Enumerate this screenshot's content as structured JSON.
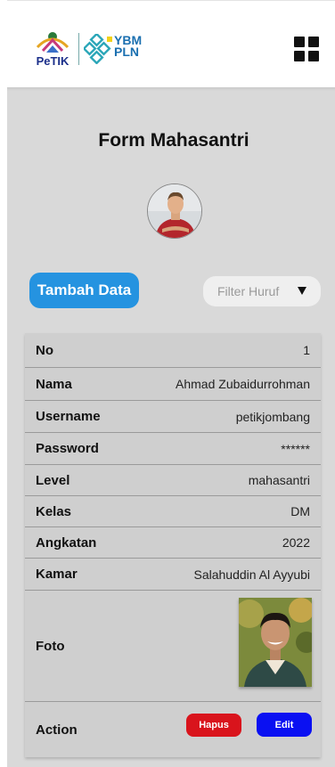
{
  "header": {
    "logo_petik_text": "PeTIK",
    "logo_ybm_line1": "YBM",
    "logo_ybm_line2": "PLN",
    "menu_icon": "grid-menu-icon"
  },
  "page": {
    "title": "Form Mahasantri",
    "avatar_icon": "user-avatar"
  },
  "toolbar": {
    "add_label": "Tambah Data",
    "filter_placeholder": "Filter Huruf",
    "filter_icon": "caret-down-icon"
  },
  "record": {
    "rows": [
      {
        "label": "No",
        "value": "1"
      },
      {
        "label": "Nama",
        "value": "Ahmad Zubaidurrohman"
      },
      {
        "label": "Username",
        "value": "petikjombang"
      },
      {
        "label": "Password",
        "value": "******"
      },
      {
        "label": "Level",
        "value": "mahasantri"
      },
      {
        "label": "Kelas",
        "value": "DM"
      },
      {
        "label": "Angkatan",
        "value": "2022"
      },
      {
        "label": "Kamar",
        "value": "Salahuddin Al Ayyubi"
      }
    ],
    "foto_label": "Foto",
    "action_label": "Action",
    "delete_label": "Hapus",
    "edit_label": "Edit"
  },
  "colors": {
    "primary": "#2593e0",
    "danger": "#d9141c",
    "edit": "#0a10f2",
    "panel": "#d9d9d9"
  }
}
